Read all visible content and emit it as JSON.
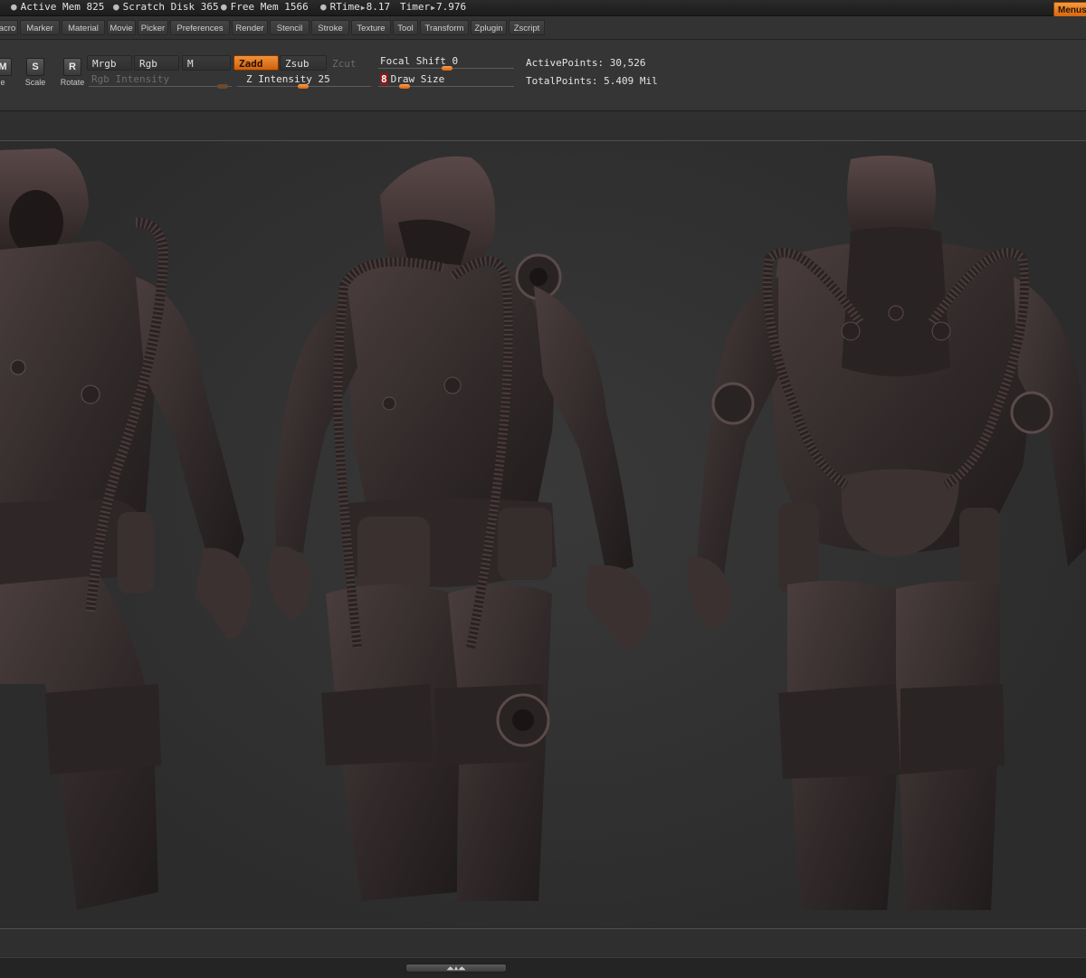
{
  "status": {
    "active_mem": "Active Mem 825",
    "scratch_disk": "Scratch Disk 365",
    "free_mem": "Free Mem 1566",
    "rtime_label": "RTime",
    "rtime_value": "8.17",
    "timer_label": "Timer",
    "timer_value": "7.976",
    "menus_label": "Menus"
  },
  "menu": {
    "items": [
      "acro",
      "Marker",
      "Material",
      "Movie",
      "Picker",
      "Preferences",
      "Render",
      "Stencil",
      "Stroke",
      "Texture",
      "Tool",
      "Transform",
      "Zplugin",
      "Zscript"
    ]
  },
  "toolbar": {
    "tools": [
      {
        "letter": "M",
        "label": "e"
      },
      {
        "letter": "S",
        "label": "Scale"
      },
      {
        "letter": "R",
        "label": "Rotate"
      }
    ],
    "mrgb": "Mrgb",
    "rgb": "Rgb",
    "m": "M",
    "rgb_intensity": "Rgb Intensity",
    "zadd": "Zadd",
    "zsub": "Zsub",
    "zcut": "Zcut",
    "z_intensity": "Z Intensity 25",
    "focal_shift_label": "Focal Shift",
    "focal_shift_value": "0",
    "draw_size_value": "8",
    "draw_size_label": "Draw Size",
    "active_points": "ActivePoints: 30,526",
    "total_points": "TotalPoints: 5.409 Mil"
  },
  "colors": {
    "accent": "#e07a1f",
    "model": "#3a3232",
    "background": "#2c2c2c"
  },
  "canvas": {
    "figures": [
      "front-view",
      "three-quarter-view",
      "back-view"
    ]
  },
  "bottom": {
    "scroll_glyph": "◢◣▲◢◣"
  }
}
